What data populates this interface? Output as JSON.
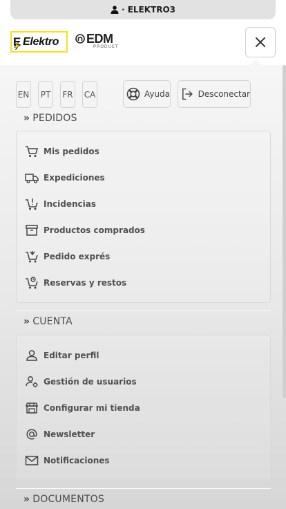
{
  "topbar": {
    "user_label": "· ELEKTRO3"
  },
  "brand": {
    "elektro_logo": "Elektro",
    "edm_logo": "EDM",
    "edm_sub": "PRODUCT"
  },
  "languages": [
    "EN",
    "PT",
    "FR",
    "CA"
  ],
  "actions": {
    "help": "Ayuda",
    "logout": "Desconectar"
  },
  "sections": {
    "pedidos": {
      "title": "PEDIDOS",
      "items": [
        {
          "label": "Mis pedidos",
          "icon": "cart-icon"
        },
        {
          "label": "Expediciones",
          "icon": "truck-icon"
        },
        {
          "label": "Incidencias",
          "icon": "cart-alert-icon"
        },
        {
          "label": "Productos comprados",
          "icon": "archive-icon"
        },
        {
          "label": "Pedido exprés",
          "icon": "cart-express-icon"
        },
        {
          "label": "Reservas y restos",
          "icon": "cart-reserve-icon"
        }
      ]
    },
    "cuenta": {
      "title": "CUENTA",
      "items": [
        {
          "label": "Editar perfil",
          "icon": "user-icon"
        },
        {
          "label": "Gestión de usuarios",
          "icon": "user-gear-icon"
        },
        {
          "label": "Configurar mi tienda",
          "icon": "store-icon"
        },
        {
          "label": "Newsletter",
          "icon": "at-icon"
        },
        {
          "label": "Notificaciones",
          "icon": "mail-icon"
        }
      ]
    },
    "documentos": {
      "title": "DOCUMENTOS"
    }
  },
  "colors": {
    "brand_yellow": "#f5e120",
    "panel_bg": "#ececec",
    "text": "#505050"
  }
}
